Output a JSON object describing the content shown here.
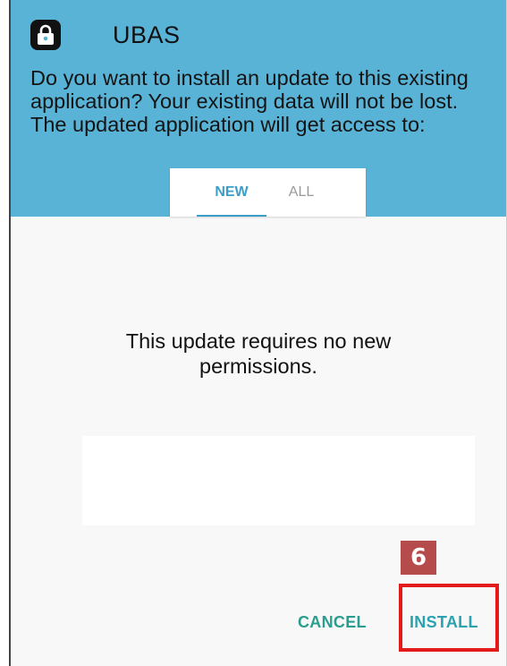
{
  "app": {
    "name": "UBAS",
    "icon": "lock-icon"
  },
  "prompt": {
    "text": "Do you want to install an update to this existing application? Your existing data will not be lost. The updated application will get access to:"
  },
  "tabs": [
    {
      "label": "NEW",
      "selected": true
    },
    {
      "label": "ALL",
      "selected": false
    }
  ],
  "body": {
    "message_line1": "This update requires no new",
    "message_line2": "permissions."
  },
  "annotation": {
    "step": "6"
  },
  "buttons": {
    "cancel": "CANCEL",
    "install": "INSTALL"
  },
  "colors": {
    "header_bg": "#59b3d6",
    "accent": "#3a9fc6",
    "button_text": "#2a9d8f",
    "highlight": "#e31b1b",
    "badge_bg": "#b54b4a"
  }
}
